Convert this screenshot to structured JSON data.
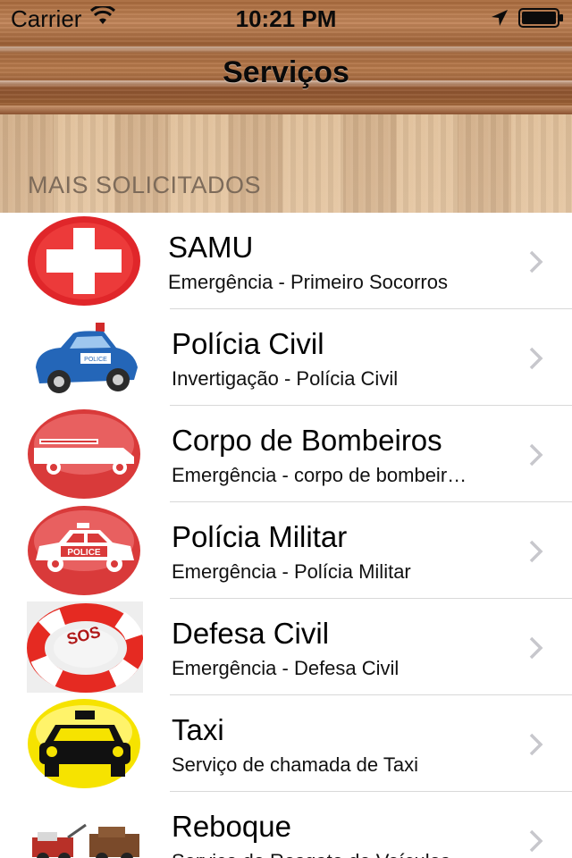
{
  "status_bar": {
    "carrier": "Carrier",
    "time": "10:21 PM",
    "icons": [
      "wifi-icon",
      "location-icon",
      "battery-icon"
    ]
  },
  "nav": {
    "title": "Serviços"
  },
  "section": {
    "header": "MAIS SOLICITADOS"
  },
  "services": [
    {
      "title": "SAMU",
      "subtitle": "Emergência - Primeiro Socorros",
      "icon": "red-cross-icon"
    },
    {
      "title": "Polícia Civil",
      "subtitle": "Invertigação - Polícia Civil",
      "icon": "police-car-toy-icon"
    },
    {
      "title": "Corpo de Bombeiros",
      "subtitle": "Emergência - corpo de bombeir…",
      "icon": "fire-truck-icon"
    },
    {
      "title": "Polícia Militar",
      "subtitle": "Emergência - Polícia Militar",
      "icon": "police-car-icon"
    },
    {
      "title": "Defesa Civil",
      "subtitle": "Emergência - Defesa Civil",
      "icon": "sos-lifebuoy-icon"
    },
    {
      "title": "Taxi",
      "subtitle": "Serviço de chamada de Taxi",
      "icon": "taxi-icon"
    },
    {
      "title": "Reboque",
      "subtitle": "Serviço de Resgate de Veículos",
      "icon": "tow-truck-icon"
    }
  ],
  "colors": {
    "wood_dark": "#9a5e34",
    "wood_light": "#e2c3a0",
    "section_text": "#7d6b5a",
    "emergency_red": "#e0262a",
    "taxi_yellow": "#f6e300"
  }
}
